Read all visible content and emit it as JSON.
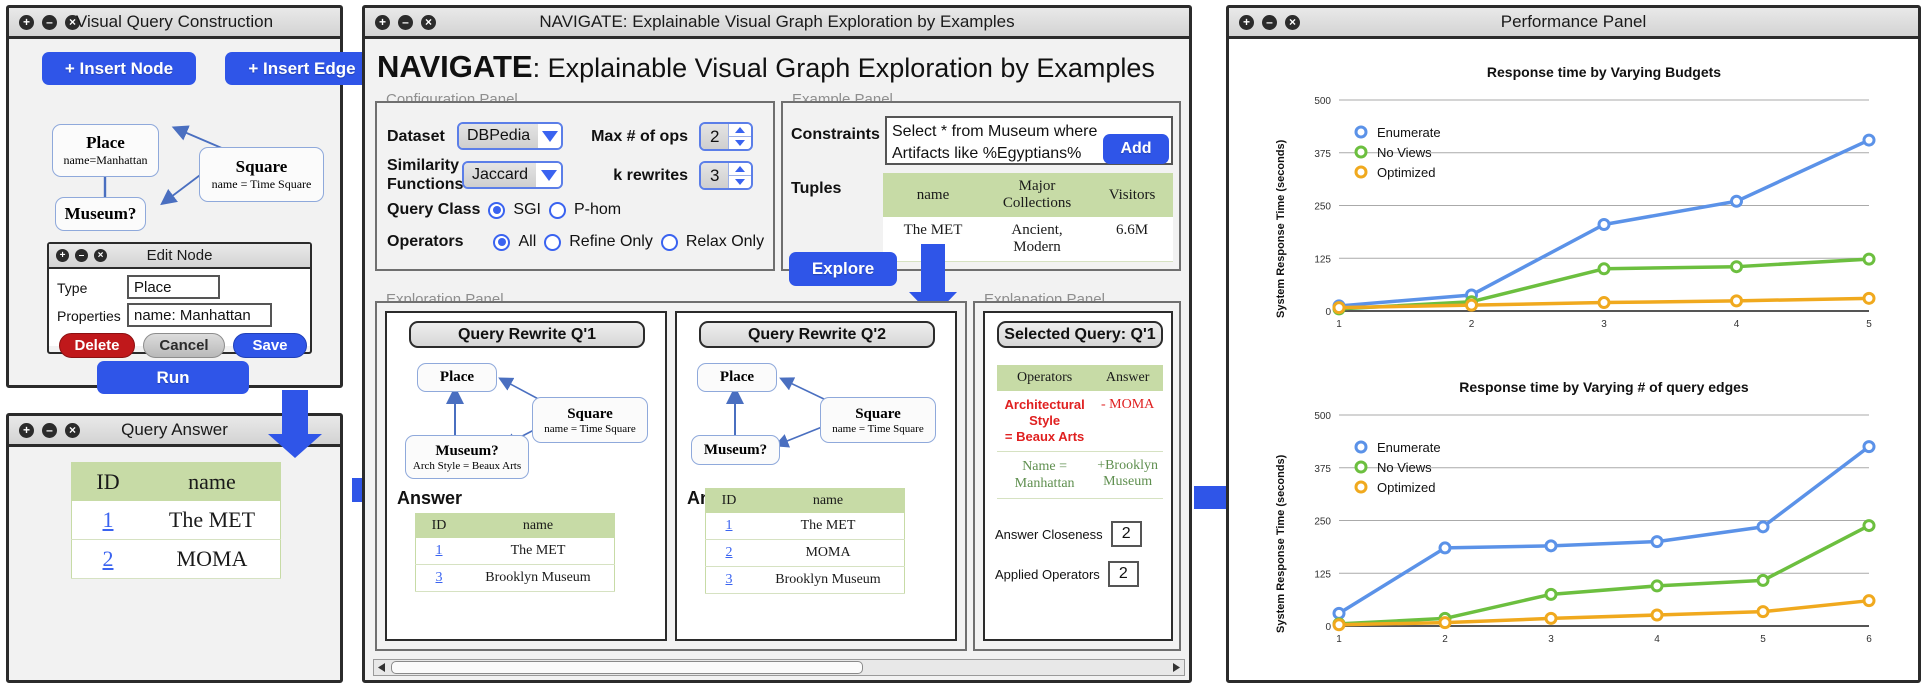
{
  "windows": {
    "left_top": {
      "title": "Visual Query Construction",
      "insert_node_label": "+ Insert Node",
      "insert_edge_label": "+ Insert Edge",
      "run_label": "Run",
      "graph": {
        "nodes": [
          {
            "type": "Place",
            "props": "name=Manhattan"
          },
          {
            "type": "Square",
            "props": "name = Time Square"
          },
          {
            "type": "Museum?",
            "props": ""
          }
        ]
      },
      "edit_node": {
        "title": "Edit Node",
        "type_label": "Type",
        "type_value": "Place",
        "properties_label": "Properties",
        "properties_value": "name: Manhattan",
        "delete_label": "Delete",
        "cancel_label": "Cancel",
        "save_label": "Save"
      }
    },
    "left_bottom": {
      "title": "Query Answer",
      "table": {
        "headers": [
          "ID",
          "name"
        ],
        "rows": [
          [
            "1",
            "The MET"
          ],
          [
            "2",
            "MOMA"
          ]
        ]
      }
    },
    "center": {
      "title": "NAVIGATE: Explainable Visual Graph Exploration by Examples",
      "heading_bold": "NAVIGATE",
      "heading_rest": ": Explainable Visual Graph Exploration by Examples",
      "configuration_panel": {
        "label": "Configuration Panel",
        "dataset_label": "Dataset",
        "dataset_value": "DBPedia",
        "similarity_label_line1": "Similarity",
        "similarity_label_line2": "Functions",
        "similarity_value": "Jaccard",
        "query_class_label": "Query Class",
        "query_class_options": [
          "SGI",
          "P-hom"
        ],
        "query_class_selected": "SGI",
        "operators_label": "Operators",
        "operators_options": [
          "All",
          "Refine Only",
          "Relax Only"
        ],
        "operators_selected": "All",
        "max_ops_label": "Max # of ops",
        "max_ops_value": "2",
        "k_rewrites_label": "k rewrites",
        "k_rewrites_value": "3"
      },
      "example_panel": {
        "label": "Example Panel",
        "constraints_label": "Constraints",
        "constraints_value_line1": "Select * from Museum where",
        "constraints_value_line2": "Artifacts like %Egyptians%",
        "add_label": "Add",
        "tuples_label": "Tuples",
        "tuples_table": {
          "headers": [
            "name",
            "Major Collections",
            "Visitors"
          ],
          "rows": [
            [
              "The MET",
              "Ancient, Modern",
              "6.6M"
            ]
          ]
        },
        "explore_label": "Explore"
      },
      "exploration_panel": {
        "label": "Exploration Panel",
        "rewrites": [
          {
            "title": "Query Rewrite Q'1",
            "nodes": [
              {
                "type": "Place",
                "props": ""
              },
              {
                "type": "Square",
                "props": "name = Time Square"
              },
              {
                "type": "Museum?",
                "props": "Arch Style = Beaux Arts"
              }
            ],
            "answer_label": "Answer",
            "table": {
              "headers": [
                "ID",
                "name"
              ],
              "rows": [
                [
                  "1",
                  "The MET"
                ],
                [
                  "3",
                  "Brooklyn Museum"
                ]
              ]
            }
          },
          {
            "title": "Query Rewrite Q'2",
            "nodes": [
              {
                "type": "Place",
                "props": ""
              },
              {
                "type": "Square",
                "props": "name = Time Square"
              },
              {
                "type": "Museum?",
                "props": ""
              }
            ],
            "answer_label": "Answer",
            "table": {
              "headers": [
                "ID",
                "name"
              ],
              "rows": [
                [
                  "1",
                  "The MET"
                ],
                [
                  "2",
                  "MOMA"
                ],
                [
                  "3",
                  "Brooklyn Museum"
                ]
              ]
            }
          }
        ]
      },
      "explanation_panel": {
        "label": "Explanation Panel",
        "selected_query_label": "Selected Query: Q'1",
        "table": {
          "headers": [
            "Operators",
            "Answer"
          ],
          "rows": [
            {
              "operator_line1": "Architectural Style",
              "operator_line2": "= Beaux Arts",
              "answer": "- MOMA",
              "color": "#e02020"
            },
            {
              "operator_line1": "Name =",
              "operator_line2": "Manhattan",
              "answer": "+Brooklyn Museum",
              "color": "#5f8f4f"
            }
          ]
        },
        "answer_closeness_label": "Answer Closeness",
        "answer_closeness_value": "2",
        "applied_operators_label": "Applied Operators",
        "applied_operators_value": "2"
      }
    },
    "right": {
      "title": "Performance Panel"
    }
  },
  "colors": {
    "enumerate": "#5b92e8",
    "no_views": "#6cbf3f",
    "optimized": "#f0a91e",
    "accent_blue": "#2f55e8",
    "table_header_green": "#c7dba6",
    "delete_red": "#c0181b"
  },
  "chart_data": [
    {
      "type": "line",
      "title": "Response time by Varying Budgets",
      "xlabel": "",
      "ylabel": "System Response Time (seconds)",
      "x": [
        1,
        2,
        3,
        4,
        5
      ],
      "xticks": [
        "1",
        "2",
        "3",
        "4",
        "5"
      ],
      "yticks": [
        "0",
        "125",
        "250",
        "375",
        "500"
      ],
      "ylim": [
        0,
        500
      ],
      "grid": true,
      "legend_position": "top-left",
      "series": [
        {
          "name": "Enumerate",
          "color": "#5b92e8",
          "values": [
            12,
            38,
            205,
            260,
            405
          ]
        },
        {
          "name": "No Views",
          "color": "#6cbf3f",
          "values": [
            5,
            22,
            100,
            105,
            123
          ]
        },
        {
          "name": "Optimized",
          "color": "#f0a91e",
          "values": [
            8,
            14,
            20,
            24,
            30
          ]
        }
      ]
    },
    {
      "type": "line",
      "title": "Response time by Varying # of query edges",
      "xlabel": "",
      "ylabel": "System Response Time (seconds)",
      "x": [
        1,
        2,
        3,
        4,
        5,
        6
      ],
      "xticks": [
        "1",
        "2",
        "3",
        "4",
        "5",
        "6"
      ],
      "yticks": [
        "0",
        "125",
        "250",
        "375",
        "500"
      ],
      "ylim": [
        0,
        500
      ],
      "grid": true,
      "legend_position": "top-left",
      "series": [
        {
          "name": "Enumerate",
          "color": "#5b92e8",
          "values": [
            30,
            185,
            190,
            200,
            235,
            425
          ]
        },
        {
          "name": "No Views",
          "color": "#6cbf3f",
          "values": [
            5,
            18,
            75,
            95,
            108,
            238
          ]
        },
        {
          "name": "Optimized",
          "color": "#f0a91e",
          "values": [
            3,
            8,
            18,
            26,
            34,
            60
          ]
        }
      ]
    }
  ]
}
